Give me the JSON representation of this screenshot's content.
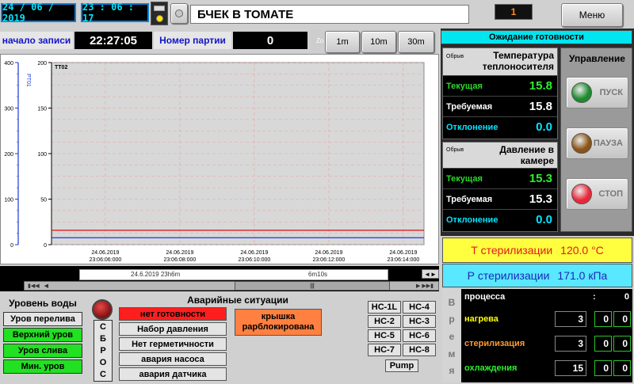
{
  "header": {
    "date": "24 / 06 / 2019",
    "time": "23 : 06 : 17",
    "title": "БЧЕК В ТОМАТЕ",
    "counter": "1",
    "menu_label": "Меню"
  },
  "record": {
    "start_label": "начало записи",
    "start_time": "22:27:05",
    "batch_label": "Номер партии",
    "batch_value": "0",
    "zoom_label": "Zo",
    "zoom_buttons": [
      "1m",
      "10m",
      "30m"
    ]
  },
  "status": {
    "text": "Ожидание готовности",
    "color": "#00e5f0"
  },
  "coolant": {
    "open_label": "Обрыв",
    "title": "Температура теплоносителя",
    "rows": [
      {
        "label": "Текущая",
        "value": "15.8",
        "label_color": "#2cd82c",
        "value_color": "#2cf02c"
      },
      {
        "label": "Требуемая",
        "value": "15.8",
        "label_color": "#ffffff",
        "value_color": "#ffffff"
      },
      {
        "label": "Отклонение",
        "value": "0.0",
        "label_color": "#00e5ff",
        "value_color": "#00e5ff"
      }
    ]
  },
  "pressure": {
    "open_label": "Обрыв",
    "title": "Давление в камере",
    "rows": [
      {
        "label": "Текущая",
        "value": "15.3",
        "label_color": "#2cd82c",
        "value_color": "#2cf02c"
      },
      {
        "label": "Требуемая",
        "value": "15.3",
        "label_color": "#ffffff",
        "value_color": "#ffffff"
      },
      {
        "label": "Отклонение",
        "value": "0.0",
        "label_color": "#00e5ff",
        "value_color": "#00e5ff"
      }
    ]
  },
  "control": {
    "title": "Управление",
    "buttons": [
      {
        "label": "ПУСК",
        "lamp": "#1e8a2e"
      },
      {
        "label": "ПАУЗА",
        "lamp": "#8a5418"
      },
      {
        "label": "СТОП",
        "lamp": "#e8283a"
      }
    ]
  },
  "sterilization": {
    "temp_label": "Т  стерилизации",
    "temp_value": "120.0 °C",
    "pressure_label": "Р стерилизации",
    "pressure_value": "171.0 кПа"
  },
  "time_table": {
    "vertical_label": "Время",
    "process_label": "процесса",
    "process_sep": ":",
    "process_value": "0",
    "rows": [
      {
        "label": "нагрева",
        "color": "#ffff00",
        "a": "3",
        "b": "0",
        "c": "0"
      },
      {
        "label": "стерилизация",
        "color": "#ff9a2e",
        "a": "3",
        "b": "0",
        "c": "0"
      },
      {
        "label": "охлаждения",
        "color": "#2cf02c",
        "a": "15",
        "b": "0",
        "c": "0"
      }
    ]
  },
  "water": {
    "title": "Уровень воды",
    "items": [
      {
        "label": "Уров перелива",
        "bg": "#e4e4e4"
      },
      {
        "label": "Верхний уров",
        "bg": "#22e022"
      },
      {
        "label": "Уров слива",
        "bg": "#22e022"
      },
      {
        "label": "Мин. уров",
        "bg": "#22e022"
      }
    ]
  },
  "reset": {
    "letters": [
      "С",
      "Б",
      "Р",
      "О",
      "С"
    ]
  },
  "alarms": {
    "title": "Аварийные ситуации",
    "items": [
      {
        "label": "нет готовности",
        "bg": "#ff1e1e"
      },
      {
        "label": "Набор давления",
        "bg": "#e4e4e4"
      },
      {
        "label": "Нет герметичности",
        "bg": "#e4e4e4"
      },
      {
        "label": "авария насоса",
        "bg": "#e4e4e4"
      },
      {
        "label": "авария датчика",
        "bg": "#e4e4e4"
      }
    ],
    "lid_label": "крышка\nрарблокирована",
    "lid_color": "#ff8040"
  },
  "pumps": {
    "buttons": [
      "НС-1L",
      "НС-4",
      "НС-2",
      "НС-3",
      "НС-5",
      "НС-6",
      "НС-7",
      "НС-8"
    ],
    "pump_label": "Pump"
  },
  "chart_data": {
    "type": "line",
    "left_axis_label": "PT01",
    "left_ticks": [
      0,
      100,
      200,
      300,
      400
    ],
    "right_axis_label": "TT02",
    "right_ticks": [
      0,
      50,
      100,
      150,
      200
    ],
    "x_labels": [
      "24.06.2019\n23:06:06:000",
      "24.06.2019\n23:06:08:000",
      "24.06.2019\n23:06:10:000",
      "24.06.2019\n23:06:12:000",
      "24.06.2019\n23:06:14:000"
    ],
    "ylim": [
      0,
      200
    ],
    "series": [
      {
        "color": "#e02020",
        "values": [
          15.8,
          15.8,
          15.8,
          15.8,
          15.8
        ]
      },
      {
        "color": "#1e3ad8",
        "values": [
          7.6,
          7.6,
          7.6,
          7.6,
          7.6
        ]
      }
    ],
    "scroll_left": "24.6.2019 23h6m",
    "scroll_mid": "6m10s"
  }
}
